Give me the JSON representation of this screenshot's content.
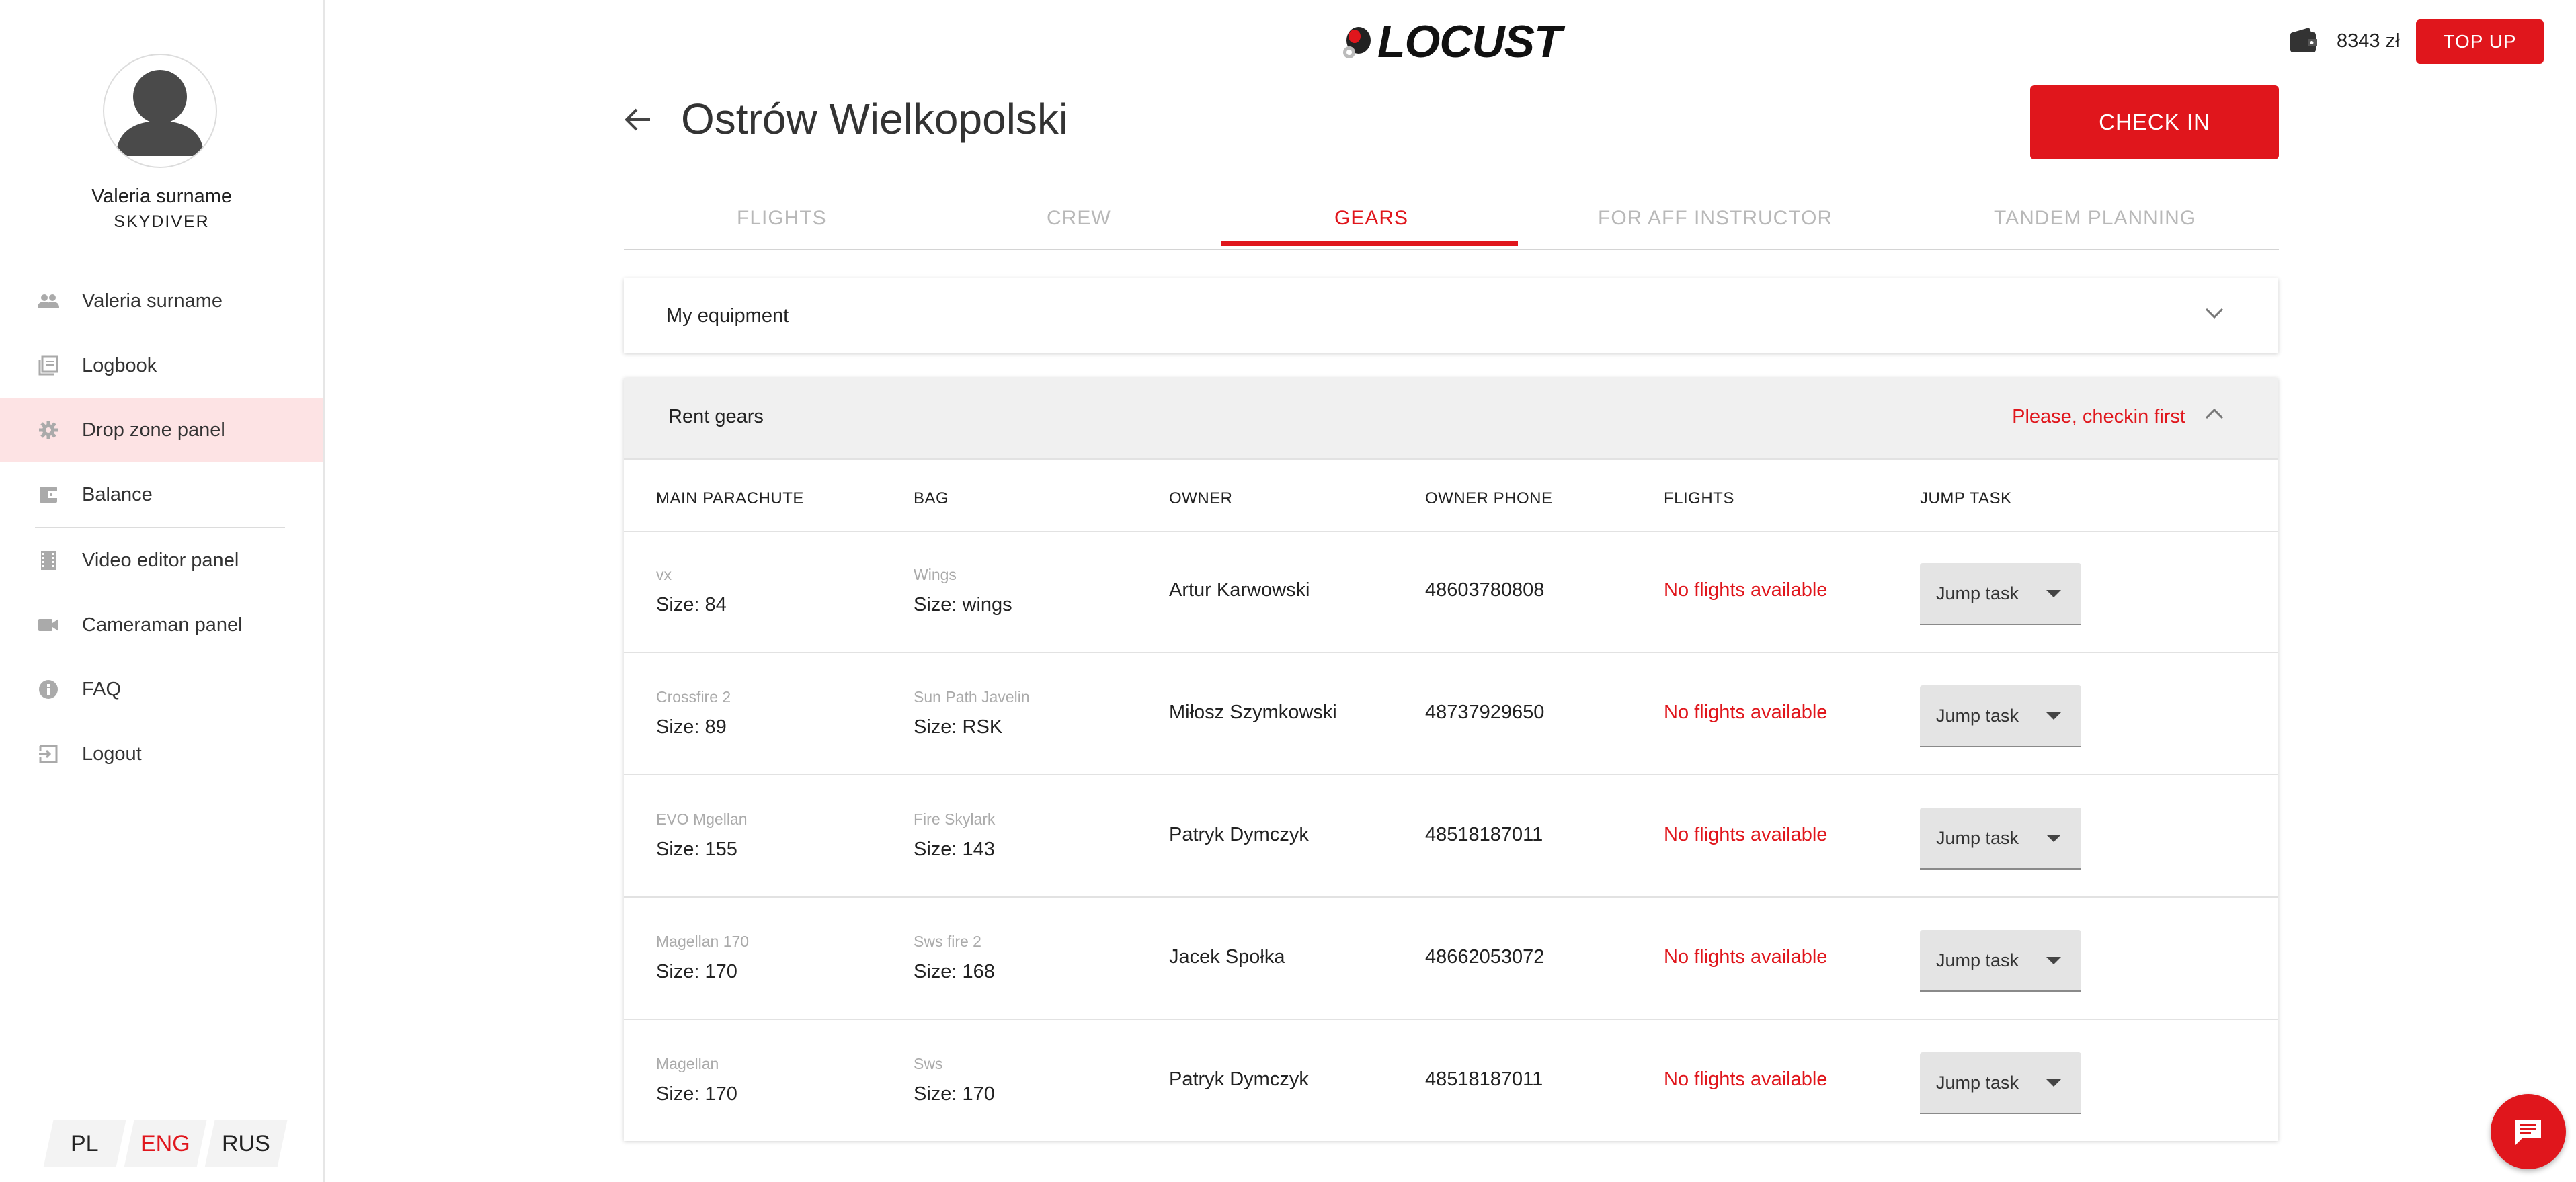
{
  "brand": {
    "name": "LOCUST"
  },
  "user": {
    "name": "Valeria surname",
    "role": "SKYDIVER"
  },
  "sidebar": {
    "items": [
      {
        "label": "Valeria surname",
        "icon": "people-icon"
      },
      {
        "label": "Logbook",
        "icon": "book-icon"
      },
      {
        "label": "Drop zone panel",
        "icon": "gear-icon",
        "active": true
      },
      {
        "label": "Balance",
        "icon": "wallet-icon"
      },
      {
        "label": "Video editor panel",
        "icon": "film-icon"
      },
      {
        "label": "Cameraman panel",
        "icon": "video-camera-icon"
      },
      {
        "label": "FAQ",
        "icon": "info-icon"
      },
      {
        "label": "Logout",
        "icon": "logout-icon"
      }
    ]
  },
  "languages": [
    "PL",
    "ENG",
    "RUS"
  ],
  "active_language": "ENG",
  "header": {
    "balance": "8343 zł",
    "topup_label": "TOP UP"
  },
  "page": {
    "title": "Ostrów Wielkopolski",
    "checkin_label": "CHECK IN"
  },
  "tabs": [
    "FLIGHTS",
    "CREW",
    "GEARS",
    "FOR AFF INSTRUCTOR",
    "TANDEM PLANNING"
  ],
  "active_tab": "GEARS",
  "equipment": {
    "title": "My equipment"
  },
  "rent": {
    "title": "Rent gears",
    "warning": "Please, checkin first",
    "columns": [
      "MAIN PARACHUTE",
      "BAG",
      "OWNER",
      "OWNER PHONE",
      "FLIGHTS",
      "JUMP TASK"
    ],
    "rows": [
      {
        "main_name": "vx",
        "main_size": "Size: 84",
        "bag_name": "Wings",
        "bag_size": "Size: wings",
        "owner": "Artur Karwowski",
        "phone": "48603780808",
        "flights": "No flights available",
        "jump_task": "Jump task"
      },
      {
        "main_name": "Crossfire 2",
        "main_size": "Size: 89",
        "bag_name": "Sun Path  Javelin",
        "bag_size": "Size: RSK",
        "owner": "Miłosz Szymkowski",
        "phone": "48737929650",
        "flights": "No flights available",
        "jump_task": "Jump task"
      },
      {
        "main_name": "EVO Mgellan",
        "main_size": "Size: 155",
        "bag_name": "Fire Skylark",
        "bag_size": "Size: 143",
        "owner": "Patryk Dymczyk",
        "phone": "48518187011",
        "flights": "No flights available",
        "jump_task": "Jump task"
      },
      {
        "main_name": "Magellan 170",
        "main_size": "Size: 170",
        "bag_name": "Sws fire 2",
        "bag_size": "Size: 168",
        "owner": "Jacek  Społka",
        "phone": "48662053072",
        "flights": "No flights available",
        "jump_task": "Jump task"
      },
      {
        "main_name": "Magellan",
        "main_size": "Size: 170",
        "bag_name": "Sws",
        "bag_size": "Size: 170",
        "owner": "Patryk Dymczyk",
        "phone": "48518187011",
        "flights": "No flights available",
        "jump_task": "Jump task"
      }
    ]
  },
  "colors": {
    "accent": "#e0161c",
    "active_nav_bg": "#fde3e4",
    "muted_text": "#aaaaaa"
  }
}
